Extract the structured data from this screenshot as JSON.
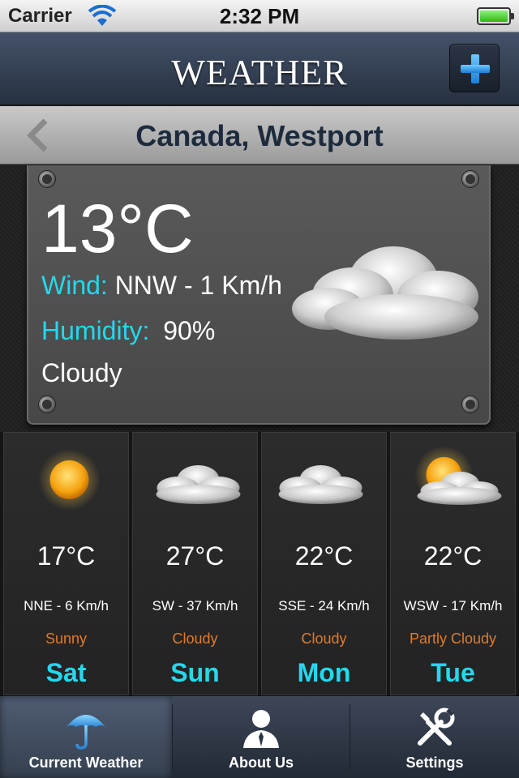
{
  "status_bar": {
    "carrier": "Carrier",
    "time": "2:32 PM"
  },
  "nav": {
    "title": "WEATHER",
    "add_icon": "plus-icon"
  },
  "location": {
    "name": "Canada, Westport",
    "back_icon": "chevron-left-icon"
  },
  "current": {
    "temperature": "13°C",
    "wind_label": "Wind:",
    "wind_value": "NNW - 1 Km/h",
    "humidity_label": "Humidity:",
    "humidity_value": "90%",
    "condition": "Cloudy",
    "icon": "cloud-icon"
  },
  "forecast": [
    {
      "temp": "17°C",
      "wind": "NNE - 6 Km/h",
      "condition": "Sunny",
      "day": "Sat",
      "icon": "sun-icon"
    },
    {
      "temp": "27°C",
      "wind": "SW - 37 Km/h",
      "condition": "Cloudy",
      "day": "Sun",
      "icon": "cloud-icon"
    },
    {
      "temp": "22°C",
      "wind": "SSE - 24 Km/h",
      "condition": "Cloudy",
      "day": "Mon",
      "icon": "cloud-icon"
    },
    {
      "temp": "22°C",
      "wind": "WSW - 17 Km/h",
      "condition": "Partly Cloudy",
      "day": "Tue",
      "icon": "partly-cloudy-icon"
    }
  ],
  "tabs": [
    {
      "label": "Current Weather",
      "icon": "umbrella-icon",
      "active": true
    },
    {
      "label": "About Us",
      "icon": "person-icon",
      "active": false
    },
    {
      "label": "Settings",
      "icon": "tools-icon",
      "active": false
    }
  ],
  "colors": {
    "accent": "#24d8ec",
    "condition": "#e07b2e",
    "nav": "#2f3a4b"
  }
}
